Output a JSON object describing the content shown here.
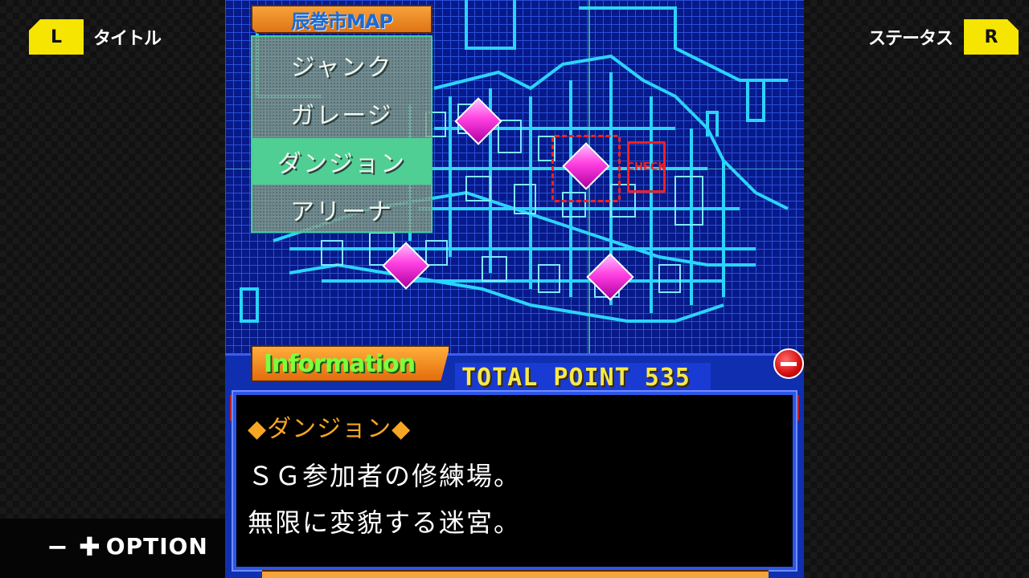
{
  "hints": {
    "left_key": "L",
    "left_label": "タイトル",
    "right_key": "R",
    "right_label": "ステータス",
    "option_symbols": "− ✚",
    "option_label": "OPTION"
  },
  "map": {
    "title": "辰巻市MAP",
    "locations": [
      {
        "label": "ジャンク",
        "selected": false
      },
      {
        "label": "ガレージ",
        "selected": false
      },
      {
        "label": "ダンジョン",
        "selected": true
      },
      {
        "label": "アリーナ",
        "selected": false
      }
    ],
    "cursor_sign_text": "CHECK"
  },
  "info": {
    "tab_label": "Information",
    "total_label": "TOTAL POINT",
    "total_value": "535",
    "heading": "◆ダンジョン◆",
    "lines": [
      "ＳＧ参加者の修練場。",
      "無限に変貌する迷宮。"
    ]
  },
  "colors": {
    "accent_yellow": "#f6e500",
    "map_cyan": "#2bd4ff",
    "gem_magenta": "#ff3ee0",
    "heading_orange": "#f5a623",
    "info_green": "#7cff3c"
  }
}
